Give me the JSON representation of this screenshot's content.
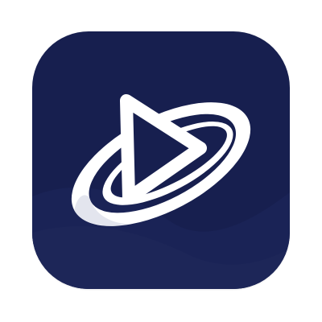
{
  "app": {
    "icon_name": "play-orbit-icon",
    "colors": {
      "page_background": "#ffffff",
      "tile_background": "#171f4f",
      "tile_wave": "#1c2457",
      "glyph": "#ffffff",
      "ring_shade": "#e4e6ee"
    }
  }
}
